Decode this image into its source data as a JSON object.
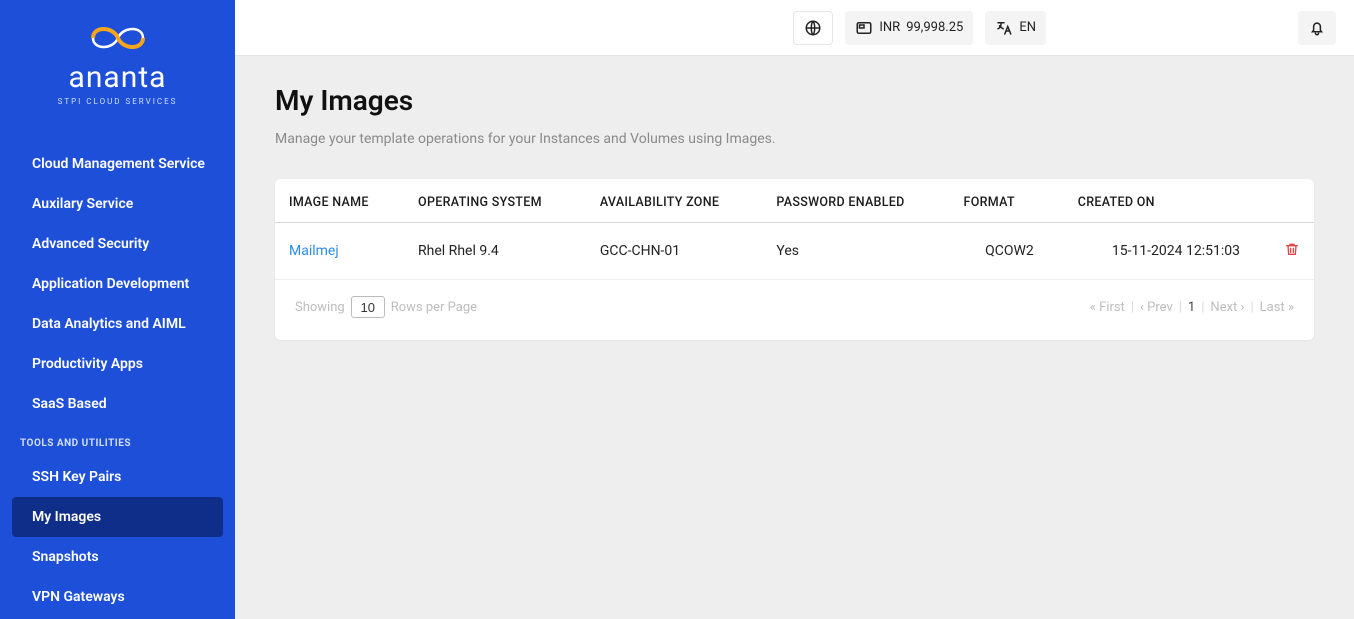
{
  "brand": {
    "name": "ananta",
    "sub": "STPI CLOUD SERVICES"
  },
  "sidebar": {
    "main_items": [
      {
        "label": "Cloud Management Service"
      },
      {
        "label": "Auxilary Service"
      },
      {
        "label": "Advanced Security"
      },
      {
        "label": "Application Development"
      },
      {
        "label": "Data Analytics and AIML"
      },
      {
        "label": "Productivity Apps"
      },
      {
        "label": "SaaS Based"
      }
    ],
    "tools_header": "TOOLS AND UTILITIES",
    "tools_items": [
      {
        "label": "SSH Key Pairs",
        "active": false
      },
      {
        "label": "My Images",
        "active": true
      },
      {
        "label": "Snapshots",
        "active": false
      },
      {
        "label": "VPN Gateways",
        "active": false
      }
    ]
  },
  "topbar": {
    "balance_currency": "INR",
    "balance_value": "99,998.25",
    "lang": "EN"
  },
  "page": {
    "title": "My Images",
    "subtitle": "Manage your template operations for your Instances and Volumes using Images."
  },
  "table": {
    "columns": [
      "IMAGE NAME",
      "OPERATING SYSTEM",
      "AVAILABILITY ZONE",
      "PASSWORD ENABLED",
      "FORMAT",
      "CREATED ON"
    ],
    "rows": [
      {
        "image_name": "Mailmej",
        "os": "Rhel Rhel 9.4",
        "zone": "GCC-CHN-01",
        "password_enabled": "Yes",
        "format": "QCOW2",
        "created_on": "15-11-2024 12:51:03"
      }
    ]
  },
  "footer": {
    "showing_label": "Showing",
    "rows_value": "10",
    "rows_per_label": "Rows per Page",
    "first": "First",
    "prev": "Prev",
    "page": "1",
    "next": "Next",
    "last": "Last"
  }
}
